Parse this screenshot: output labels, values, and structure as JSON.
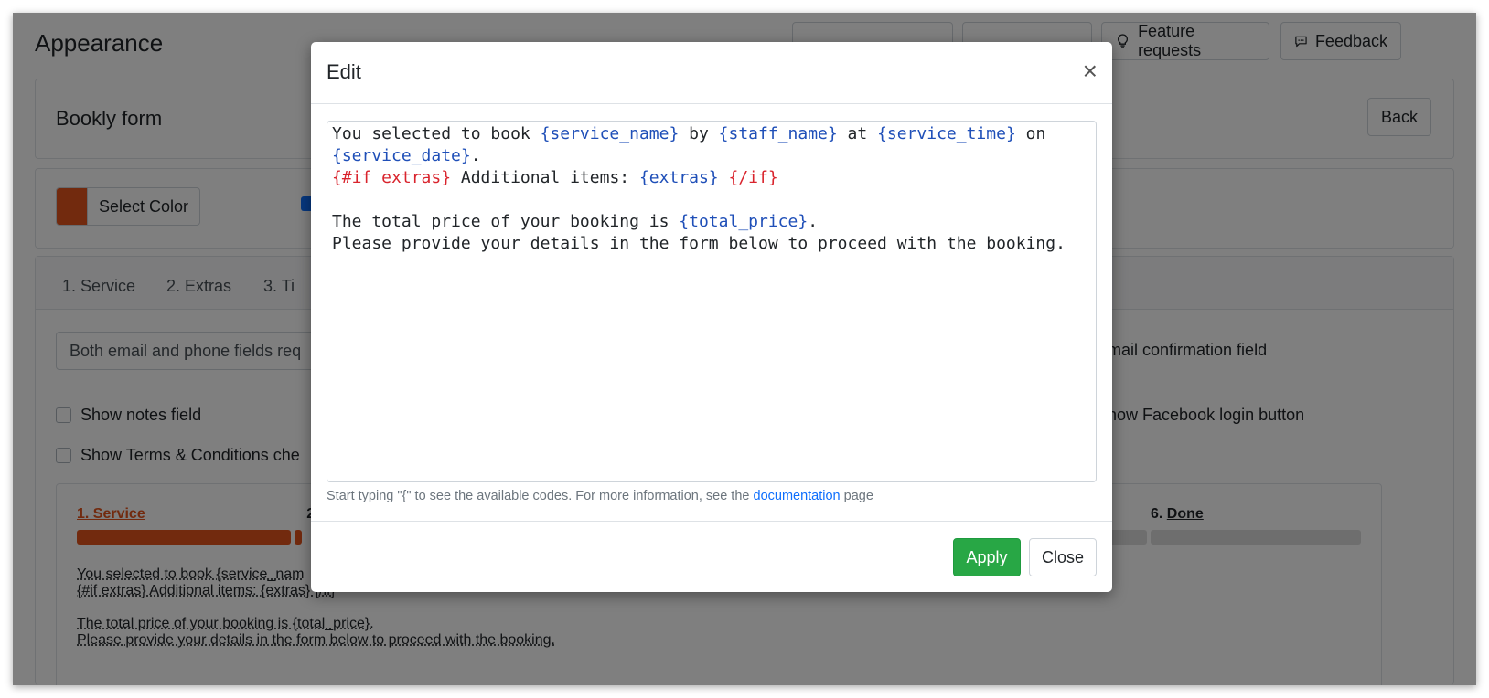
{
  "page": {
    "title": "Appearance"
  },
  "header_buttons": {
    "feature_requests": "Feature requests",
    "feedback": "Feedback"
  },
  "form_card": {
    "title": "Bookly form",
    "back_label": "Back"
  },
  "color_card": {
    "select_color_label": "Select Color",
    "accent_color": "#e4541d"
  },
  "tabs": [
    "1. Service",
    "2. Extras",
    "3. Ti"
  ],
  "settings": {
    "contact_select_value": "Both email and phone fields req",
    "email_confirmation_label": "Email confirmation field",
    "show_notes_label": "Show notes field",
    "show_facebook_label": "Show Facebook login button",
    "show_terms_label": "Show Terms & Conditions che"
  },
  "preview": {
    "step1": "1. Service",
    "step2_partial": "2",
    "step6_number": "6.",
    "step6_label": "Done",
    "text": "You selected to book {service_nam\n{#if extras} Additional items: {extras} {/if}\n\nThe total price of your booking is {total_price}.\nPlease provide your details in the form below to proceed with the booking."
  },
  "modal": {
    "title": "Edit",
    "close_symbol": "×",
    "editor": {
      "l1_a": "You selected to book ",
      "l1_var1": "{service_name}",
      "l1_b": " by ",
      "l1_var2": "{staff_name}",
      "l1_c": " at ",
      "l1_var3": "{service_time}",
      "l1_d": " on",
      "l2_var": "{service_date}",
      "l2_end": ".",
      "l3_if": "{#if extras}",
      "l3_text": " Additional items: ",
      "l3_var": "{extras}",
      "l3_space": " ",
      "l3_endif": "{/if}",
      "l5_a": "The total price of your booking is ",
      "l5_var": "{total_price}",
      "l5_end": ".",
      "l6": "Please provide your details in the form below to proceed with the booking."
    },
    "help_prefix": "Start typing \"{\" to see the available codes. For more information, see the ",
    "help_link": "documentation",
    "help_suffix": " page",
    "apply_label": "Apply",
    "close_label": "Close"
  },
  "colors": {
    "apply_green": "#28a745",
    "code_blue": "#1f4fb8",
    "code_red": "#d9242d",
    "link_blue": "#0d6efd"
  }
}
